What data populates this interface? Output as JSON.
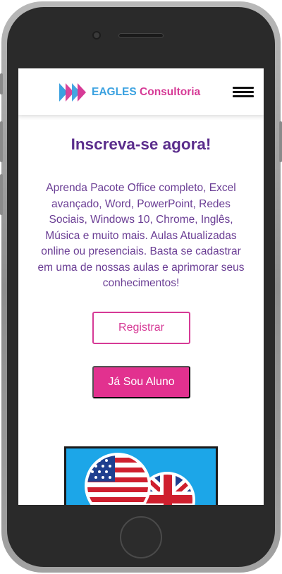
{
  "header": {
    "brand_part1": "EAGLES",
    "brand_part2": "Consultoria",
    "logo_icon": "eagles-chevron-logo",
    "menu_icon": "hamburger-menu-icon"
  },
  "main": {
    "title": "Inscreva-se agora!",
    "description": "Aprenda Pacote Office completo, Excel avançado, Word, PowerPoint, Redes Sociais, Windows 10, Chrome, Inglês, Música e muito mais. Aulas Atualizadas online ou presenciais. Basta se cadastrar em uma de nossas aulas e aprimorar seus conhecimentos!",
    "register_label": "Registrar",
    "student_label": "Já Sou Aluno",
    "image_icon": "usa-uk-flags-image"
  },
  "colors": {
    "brand_blue": "#3aa1e0",
    "brand_pink": "#d63a96",
    "title_purple": "#5b2d8c",
    "text_purple": "#6a3d94",
    "button_pink": "#e2318f"
  }
}
